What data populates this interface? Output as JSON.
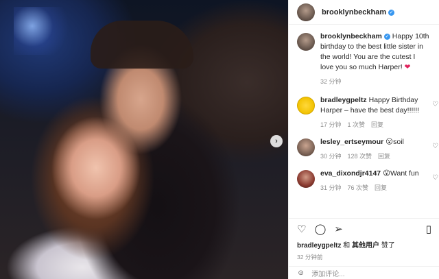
{
  "post": {
    "username": "brooklynbeckham",
    "caption_user": "brooklynbeckham",
    "caption_text": "Happy 10th birthday to the best little sister in the world! You are the cutest I love you so much Harper!",
    "caption_time": "32 分钟"
  },
  "comments": [
    {
      "user": "bradleygpeltz",
      "text": "Happy Birthday Harper – have the best day!!!!!!",
      "time": "17 分钟",
      "likes": "1 次赞",
      "reply": "回复"
    },
    {
      "user": "lesley_ertseymour",
      "text": "😮soil",
      "time": "30 分钟",
      "likes": "128 次赞",
      "reply": "回复"
    },
    {
      "user": "eva_dixondjr4147",
      "text": "😮Want fun",
      "time": "31 分钟",
      "likes": "76 次赞",
      "reply": "回复"
    }
  ],
  "likes_line": {
    "user": "bradleygpeltz",
    "and": "和",
    "others": "其他用户",
    "suffix": "赞了"
  },
  "post_time": "32 分钟前",
  "add_comment_placeholder": "添加评论...",
  "icons": [
    "heart-icon",
    "comment-icon",
    "share-icon",
    "bookmark-icon",
    "emoji-icon",
    "carousel-next-icon",
    "verified-icon"
  ]
}
